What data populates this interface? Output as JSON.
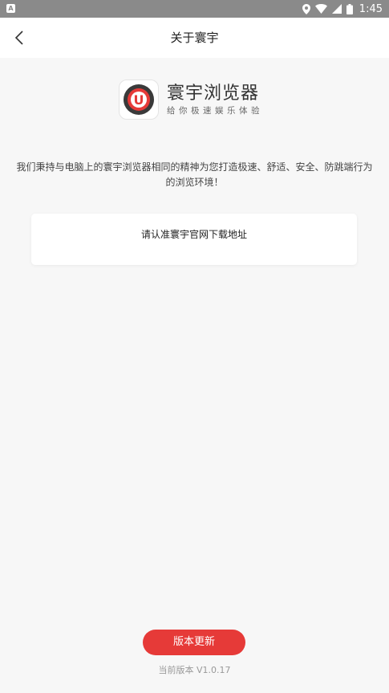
{
  "status_bar": {
    "left_icon_label": "A",
    "time": "1:45",
    "icons": [
      "location-icon",
      "wifi-icon",
      "signal-icon",
      "battery-icon"
    ]
  },
  "header": {
    "title": "关于寰宇"
  },
  "brand": {
    "name": "寰宇浏览器",
    "slogan": "给你极速娱乐体验",
    "logo_letter": "U"
  },
  "description": "我们秉持与电脑上的寰宇浏览器相同的精神为您打造极速、舒适、安全、防跳端行为的浏览环境！",
  "notice": {
    "text": "请认准寰宇官网下载地址"
  },
  "footer": {
    "update_label": "版本更新",
    "version_text": "当前版本 V1.0.17"
  },
  "colors": {
    "accent": "#e63a38",
    "background": "#f7f7f7"
  }
}
